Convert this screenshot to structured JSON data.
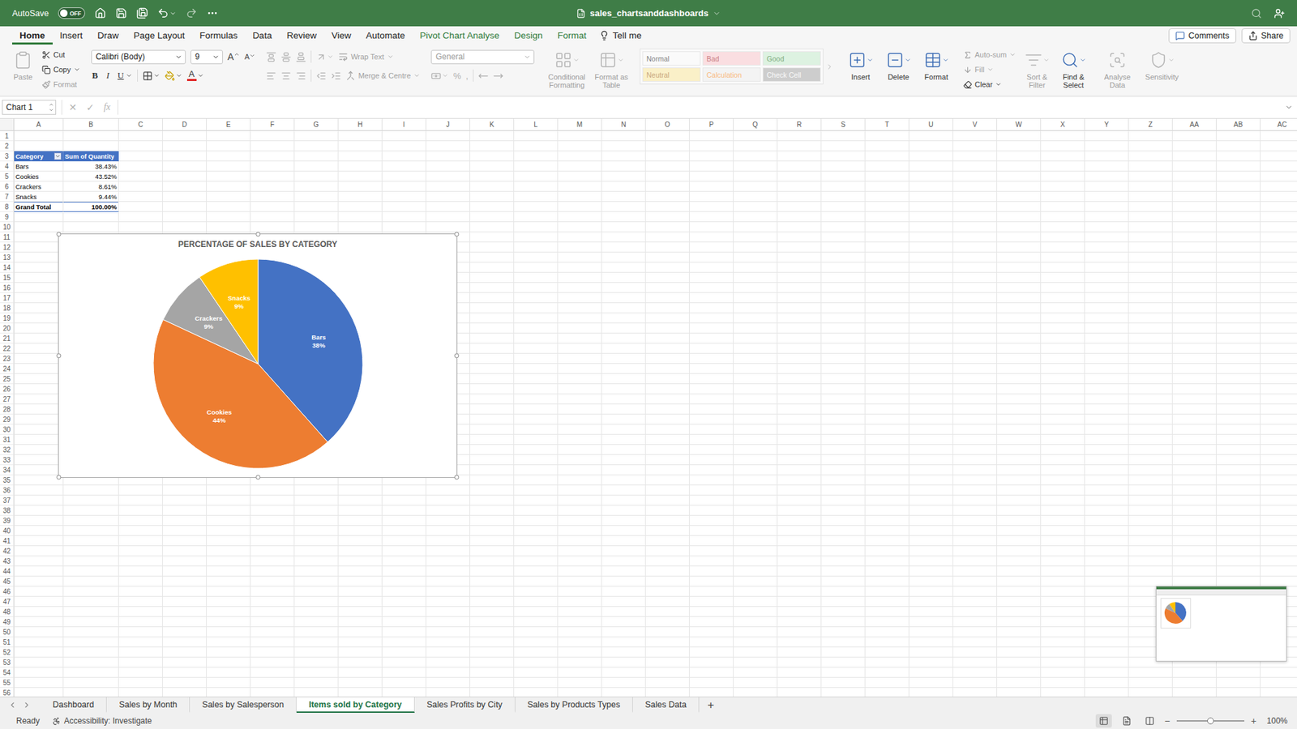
{
  "window": {
    "title": "sales_chartsanddashboards"
  },
  "autosave": {
    "label": "AutoSave",
    "state": "OFF",
    "on": false
  },
  "ribbon_tabs": [
    {
      "label": "Home",
      "selected": true,
      "kind": "standard"
    },
    {
      "label": "Insert",
      "selected": false,
      "kind": "standard"
    },
    {
      "label": "Draw",
      "selected": false,
      "kind": "standard"
    },
    {
      "label": "Page Layout",
      "selected": false,
      "kind": "standard"
    },
    {
      "label": "Formulas",
      "selected": false,
      "kind": "standard"
    },
    {
      "label": "Data",
      "selected": false,
      "kind": "standard"
    },
    {
      "label": "Review",
      "selected": false,
      "kind": "standard"
    },
    {
      "label": "View",
      "selected": false,
      "kind": "standard"
    },
    {
      "label": "Automate",
      "selected": false,
      "kind": "standard"
    },
    {
      "label": "Pivot Chart Analyse",
      "selected": false,
      "kind": "contextual"
    },
    {
      "label": "Design",
      "selected": false,
      "kind": "contextual"
    },
    {
      "label": "Format",
      "selected": false,
      "kind": "contextual"
    }
  ],
  "tell_me": "Tell me",
  "comments": "Comments",
  "share": "Share",
  "clipboard": {
    "paste": {
      "label": "Paste",
      "disabled": true
    },
    "actions": [
      {
        "label": "Cut",
        "disabled": false,
        "menu": false,
        "kind": "cut"
      },
      {
        "label": "Copy",
        "disabled": false,
        "menu": true,
        "kind": "copy"
      },
      {
        "label": "Format",
        "disabled": true,
        "menu": false,
        "kind": "format"
      }
    ]
  },
  "font": {
    "name": "Calibri (Body)",
    "size": "9",
    "grow": "A",
    "shrink": "A",
    "bold": "B",
    "italic": "I",
    "underline": "U",
    "font_color": "A"
  },
  "alignment": {
    "wrap_text": "Wrap Text",
    "merge": "Merge & Centre",
    "disabled": true
  },
  "number": {
    "format": "General",
    "percent": "%",
    "comma": ",",
    "disabled": true
  },
  "format_buttons": [
    {
      "label": "Conditional Formatting",
      "disabled": true,
      "kind": "conditional"
    },
    {
      "label": "Format as Table",
      "disabled": true,
      "kind": "table"
    }
  ],
  "styles": {
    "disabled": true,
    "items": [
      {
        "label": "Normal",
        "fill": "#ffffff",
        "color": "#000000"
      },
      {
        "label": "Bad",
        "fill": "#ffc7ce",
        "color": "#9c0006"
      },
      {
        "label": "Good",
        "fill": "#c6efce",
        "color": "#006100"
      },
      {
        "label": "Neutral",
        "fill": "#ffeb9c",
        "color": "#9c5700"
      },
      {
        "label": "Calculation",
        "fill": "#f2f2f2",
        "color": "#fa7d00"
      },
      {
        "label": "Check Cell",
        "fill": "#a5a5a5",
        "color": "#ffffff"
      }
    ]
  },
  "cells": [
    {
      "label": "Insert",
      "disabled": false,
      "kind": "insert"
    },
    {
      "label": "Delete",
      "disabled": false,
      "kind": "delete"
    },
    {
      "label": "Format",
      "disabled": false,
      "kind": "format"
    }
  ],
  "editing": {
    "actions": [
      {
        "label": "Auto-sum",
        "disabled": true,
        "kind": "sum"
      },
      {
        "label": "Fill",
        "disabled": true,
        "kind": "fill"
      },
      {
        "label": "Clear",
        "disabled": false,
        "kind": "clear"
      }
    ],
    "buttons": [
      {
        "label": "Sort & Filter",
        "disabled": true,
        "kind": "sort"
      },
      {
        "label": "Find & Select",
        "disabled": false,
        "kind": "find"
      }
    ]
  },
  "tools": [
    {
      "label": "Analyse Data",
      "disabled": true,
      "kind": "analyse"
    },
    {
      "label": "Sensitivity",
      "disabled": true,
      "kind": "sensitivity"
    }
  ],
  "formula_bar": {
    "name_box": "Chart 1",
    "cancel": "✕",
    "enter": "✓",
    "fx": "fx"
  },
  "columns": [
    "A",
    "B",
    "C",
    "D",
    "E",
    "F",
    "G",
    "H",
    "I",
    "J",
    "K",
    "L",
    "M",
    "N",
    "O",
    "P",
    "Q",
    "R",
    "S",
    "T",
    "U",
    "V",
    "W",
    "X",
    "Y",
    "Z",
    "AA",
    "AB",
    "AC"
  ],
  "rows": [
    "1",
    "2",
    "3",
    "4",
    "5",
    "6",
    "7",
    "8",
    "9",
    "10",
    "11",
    "12",
    "13",
    "14",
    "15",
    "16",
    "17",
    "18",
    "19",
    "20",
    "21",
    "22",
    "23",
    "24",
    "25",
    "26",
    "27",
    "28",
    "29",
    "30",
    "31",
    "32",
    "33",
    "34",
    "35",
    "36",
    "37",
    "38",
    "39",
    "40",
    "41",
    "42",
    "43",
    "44",
    "45",
    "46",
    "47",
    "48",
    "49",
    "50",
    "51",
    "52",
    "53",
    "54",
    "55",
    "56"
  ],
  "pivot": {
    "headers": [
      "Category",
      "Sum of Quantity"
    ],
    "rows": [
      [
        "Bars",
        "38.43%"
      ],
      [
        "Cookies",
        "43.52%"
      ],
      [
        "Crackers",
        "8.61%"
      ],
      [
        "Snacks",
        "9.44%"
      ]
    ],
    "total": [
      "Grand Total",
      "100.00%"
    ]
  },
  "chart": {
    "title": "PERCENTAGE OF SALES BY CATEGORY",
    "selected": true,
    "series": [
      {
        "label": "Bars",
        "value": 38.43,
        "data_label": "38%",
        "color": "#4472c4"
      },
      {
        "label": "Cookies",
        "value": 43.52,
        "data_label": "44%",
        "color": "#ed7d31"
      },
      {
        "label": "Crackers",
        "value": 8.61,
        "data_label": "9%",
        "color": "#a5a5a5"
      },
      {
        "label": "Snacks",
        "value": 9.44,
        "data_label": "9%",
        "color": "#ffc000"
      }
    ]
  },
  "sheet_tabs": [
    {
      "label": "Dashboard",
      "selected": false
    },
    {
      "label": "Sales by Month",
      "selected": false
    },
    {
      "label": "Sales by Salesperson",
      "selected": false
    },
    {
      "label": "Items sold by Category",
      "selected": true
    },
    {
      "label": "Sales Profits by City",
      "selected": false
    },
    {
      "label": "Sales by Products Types",
      "selected": false
    },
    {
      "label": "Sales Data",
      "selected": false
    }
  ],
  "add_sheet": "+",
  "status_bar": {
    "mode": "Ready",
    "accessibility": "Accessibility: Investigate",
    "views": [
      {
        "kind": "normal",
        "selected": true
      },
      {
        "kind": "page-layout",
        "selected": false
      },
      {
        "kind": "page-break",
        "selected": false
      }
    ],
    "zoom_out": "−",
    "zoom_in": "+",
    "zoom": "100%",
    "zoom_level": 0.5
  }
}
